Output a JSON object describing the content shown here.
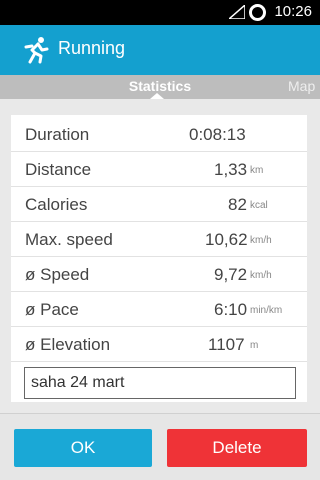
{
  "status_bar": {
    "time": "10:26"
  },
  "app_bar": {
    "title": "Running"
  },
  "tabs": {
    "active": "Statistics",
    "next": "Map"
  },
  "stats": [
    {
      "label": "Duration",
      "value": "0:08:13",
      "unit": ""
    },
    {
      "label": "Distance",
      "value": "1,33",
      "unit": "km"
    },
    {
      "label": "Calories",
      "value": "82",
      "unit": "kcal"
    },
    {
      "label": "Max. speed",
      "value": "10,62",
      "unit": "km/h"
    },
    {
      "label": "ø Speed",
      "value": "9,72",
      "unit": "km/h"
    },
    {
      "label": "ø Pace",
      "value": "6:10",
      "unit": "min/km"
    },
    {
      "label": "ø Elevation",
      "value": "1107",
      "unit": "m"
    }
  ],
  "note": {
    "value": "saha 24 mart"
  },
  "buttons": {
    "ok": "OK",
    "delete": "Delete"
  },
  "colors": {
    "accent": "#14a0cf",
    "ok": "#1aa8d6",
    "delete": "#ef3337"
  }
}
